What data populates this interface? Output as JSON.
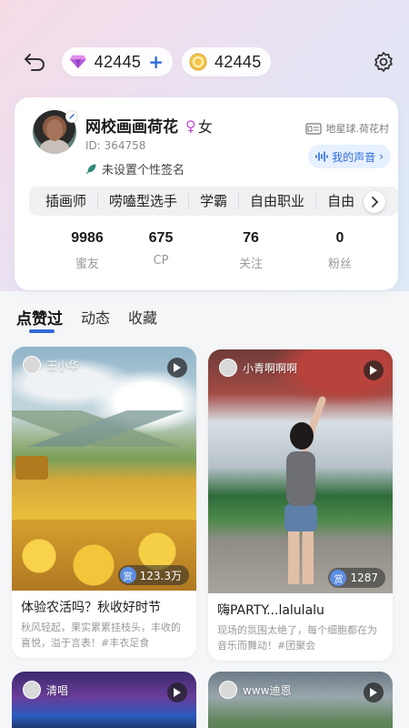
{
  "header": {
    "gems": "42445",
    "coins": "42445",
    "plus_label": "+"
  },
  "profile": {
    "name": "网校画画荷花",
    "gender_symbol": "♀",
    "gender": "女",
    "id_label": "ID: 364758",
    "signature": "未设置个性签名",
    "location": "地星球.荷花村",
    "voice_label": "我的声音",
    "tags": [
      "插画师",
      "唠嗑型选手",
      "学霸",
      "自由职业",
      "自由"
    ],
    "stats": [
      {
        "value": "9986",
        "label": "蜜友"
      },
      {
        "value": "675",
        "label": "CP"
      },
      {
        "value": "76",
        "label": "关注"
      },
      {
        "value": "0",
        "label": "粉丝"
      }
    ]
  },
  "tabs": [
    "点赞过",
    "动态",
    "收藏"
  ],
  "feed": [
    {
      "user": "王小华",
      "reward": "123.3万",
      "reward_icon": "赏",
      "title": "体验农活吗？秋收好时节",
      "desc": "秋风轻起，果实累累挂枝头，丰收的喜悦，溢于言表！#丰衣足食"
    },
    {
      "user": "小青啊啊啊",
      "reward": "1287",
      "reward_icon": "赏",
      "title": "嗨PARTY...lalulalu",
      "desc": "现场的氛围太绝了，每个细胞都在为音乐而舞动！#团聚会"
    },
    {
      "user": "清唱"
    },
    {
      "user": "www迪恩"
    }
  ],
  "colors": {
    "accent": "#2f6bd8",
    "gender": "#c24fd0"
  }
}
